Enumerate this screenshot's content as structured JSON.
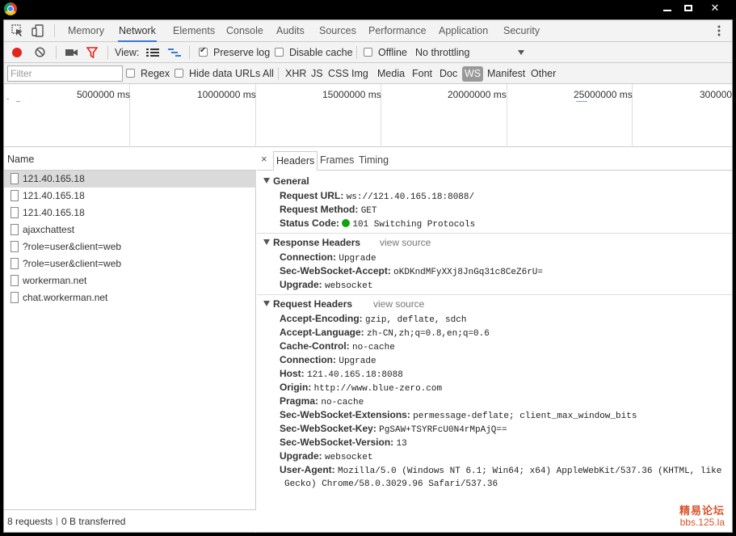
{
  "window": {
    "min": "",
    "max": "",
    "close": "✕"
  },
  "tabs": [
    "Memory",
    "Network",
    "Elements",
    "Console",
    "Audits",
    "Sources",
    "Performance",
    "Application",
    "Security"
  ],
  "toolbar": {
    "view_label": "View:",
    "preserve_log": "Preserve log",
    "preserve_log_checked": true,
    "disable_cache": "Disable cache",
    "offline": "Offline",
    "throttling": "No throttling"
  },
  "filterbar": {
    "placeholder": "Filter",
    "regex": "Regex",
    "hide_data_urls": "Hide data URLs",
    "types": [
      "All",
      "XHR",
      "JS",
      "CSS",
      "Img",
      "Media",
      "Font",
      "Doc",
      "WS",
      "Manifest",
      "Other"
    ],
    "active_type": "WS"
  },
  "overview": {
    "labels": [
      "5000000 ms",
      "10000000 ms",
      "15000000 ms",
      "20000000 ms",
      "25000000 ms",
      "300000"
    ]
  },
  "requests": {
    "header": "Name",
    "items": [
      "121.40.165.18",
      "121.40.165.18",
      "121.40.165.18",
      "ajaxchattest",
      "?role=user&client=web",
      "?role=user&client=web",
      "workerman.net",
      "chat.workerman.net"
    ],
    "status_count": "8 requests",
    "status_transferred": "0 B transferred"
  },
  "details": {
    "tabs": [
      "Headers",
      "Frames",
      "Timing"
    ],
    "close": "×",
    "general": {
      "title": "General",
      "request_url_k": "Request URL:",
      "request_url_v": "ws://121.40.165.18:8088/",
      "method_k": "Request Method:",
      "method_v": "GET",
      "status_k": "Status Code:",
      "status_v": "101 Switching Protocols"
    },
    "response_headers": {
      "title": "Response Headers",
      "view_source": "view source",
      "rows": [
        {
          "k": "Connection:",
          "v": "Upgrade"
        },
        {
          "k": "Sec-WebSocket-Accept:",
          "v": "oKDKndMFyXXj8JnGq31c8CeZ6rU="
        },
        {
          "k": "Upgrade:",
          "v": "websocket"
        }
      ]
    },
    "request_headers": {
      "title": "Request Headers",
      "view_source": "view source",
      "rows": [
        {
          "k": "Accept-Encoding:",
          "v": "gzip, deflate, sdch"
        },
        {
          "k": "Accept-Language:",
          "v": "zh-CN,zh;q=0.8,en;q=0.6"
        },
        {
          "k": "Cache-Control:",
          "v": "no-cache"
        },
        {
          "k": "Connection:",
          "v": "Upgrade"
        },
        {
          "k": "Host:",
          "v": "121.40.165.18:8088"
        },
        {
          "k": "Origin:",
          "v": "http://www.blue-zero.com"
        },
        {
          "k": "Pragma:",
          "v": "no-cache"
        },
        {
          "k": "Sec-WebSocket-Extensions:",
          "v": "permessage-deflate; client_max_window_bits"
        },
        {
          "k": "Sec-WebSocket-Key:",
          "v": "PgSAW+TSYRFcU0N4rMpAjQ=="
        },
        {
          "k": "Sec-WebSocket-Version:",
          "v": "13"
        },
        {
          "k": "Upgrade:",
          "v": "websocket"
        },
        {
          "k": "User-Agent:",
          "v": "Mozilla/5.0 (Windows NT 6.1; Win64; x64) AppleWebKit/537.36 (KHTML, like"
        }
      ],
      "ua_continuation": "Gecko) Chrome/58.0.3029.96 Safari/537.36"
    }
  },
  "watermark": {
    "cn": "精易论坛",
    "url": "bbs.125.la"
  }
}
